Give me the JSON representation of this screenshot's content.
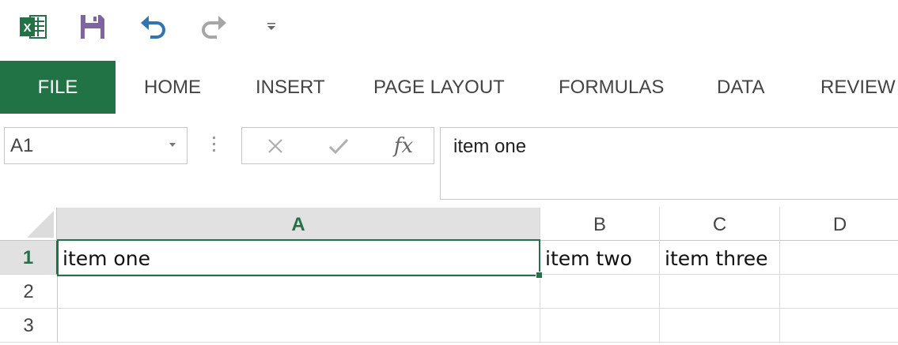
{
  "qat": {
    "icons": [
      "excel-logo-icon",
      "save-icon",
      "undo-icon",
      "redo-icon",
      "customize-dropdown-icon"
    ]
  },
  "ribbon": {
    "tabs": [
      {
        "label": "FILE"
      },
      {
        "label": "HOME"
      },
      {
        "label": "INSERT"
      },
      {
        "label": "PAGE LAYOUT"
      },
      {
        "label": "FORMULAS"
      },
      {
        "label": "DATA"
      },
      {
        "label": "REVIEW"
      }
    ]
  },
  "formula_bar": {
    "name_box": "A1",
    "fx_label": "fx",
    "value": "item one"
  },
  "grid": {
    "columns": [
      "A",
      "B",
      "C",
      "D"
    ],
    "rows": [
      "1",
      "2",
      "3"
    ],
    "cells": {
      "A1": "item one",
      "B1": "item two",
      "C1": "item three"
    },
    "active_cell": "A1"
  },
  "colors": {
    "accent": "#217346",
    "header_active_bg": "#e1e1e1",
    "gridline": "#dadada"
  }
}
